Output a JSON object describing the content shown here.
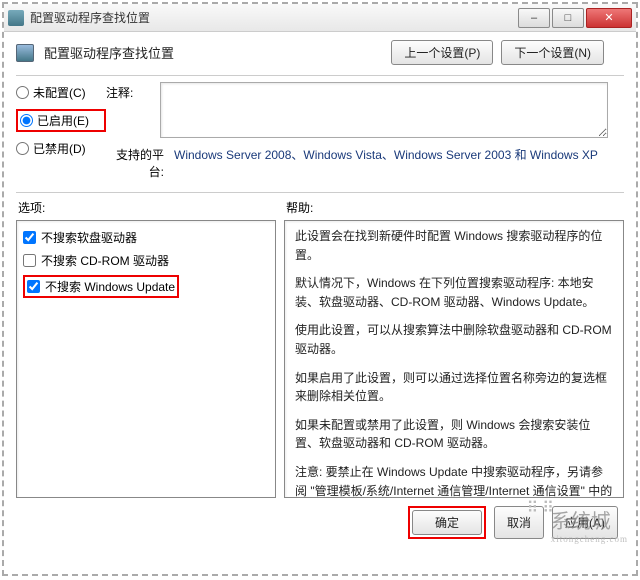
{
  "window": {
    "title": "配置驱动程序查找位置",
    "minimize": "–",
    "maximize": "□",
    "close": "✕"
  },
  "header": {
    "title": "配置驱动程序查找位置",
    "prev_btn": "上一个设置(P)",
    "next_btn": "下一个设置(N)"
  },
  "radios": {
    "not_configured": "未配置(C)",
    "enabled": "已启用(E)",
    "disabled": "已禁用(D)"
  },
  "comment": {
    "label": "注释:",
    "value": ""
  },
  "platform": {
    "label": "支持的平台:",
    "text": "Windows Server 2008、Windows Vista、Windows Server 2003 和 Windows XP"
  },
  "sections": {
    "options": "选项:",
    "help": "帮助:"
  },
  "options": {
    "no_floppy": "不搜索软盘驱动器",
    "no_cdrom": "不搜索 CD-ROM 驱动器",
    "no_wu": "不搜索 Windows Update"
  },
  "help": {
    "p1": "此设置会在找到新硬件时配置 Windows 搜索驱动程序的位置。",
    "p2": "默认情况下，Windows 在下列位置搜索驱动程序: 本地安装、软盘驱动器、CD-ROM 驱动器、Windows Update。",
    "p3": "使用此设置，可以从搜索算法中删除软盘驱动器和 CD-ROM 驱动器。",
    "p4": "如果启用了此设置，则可以通过选择位置名称旁边的复选框来删除相关位置。",
    "p5": "如果未配置或禁用了此设置，则 Windows 会搜索安装位置、软盘驱动器和 CD-ROM 驱动器。",
    "p6": "注意: 要禁止在 Windows Update 中搜索驱动程序，另请参阅 \"管理模板/系统/Internet 通信管理/Internet 通信设置\" 中的 \"关闭 Windows Update 设备驱动程序搜索\"。"
  },
  "buttons": {
    "ok": "确定",
    "cancel": "取消",
    "apply": "应用(A)"
  },
  "watermark": {
    "main": "系统城",
    "sub": "xitongcheng.com"
  }
}
